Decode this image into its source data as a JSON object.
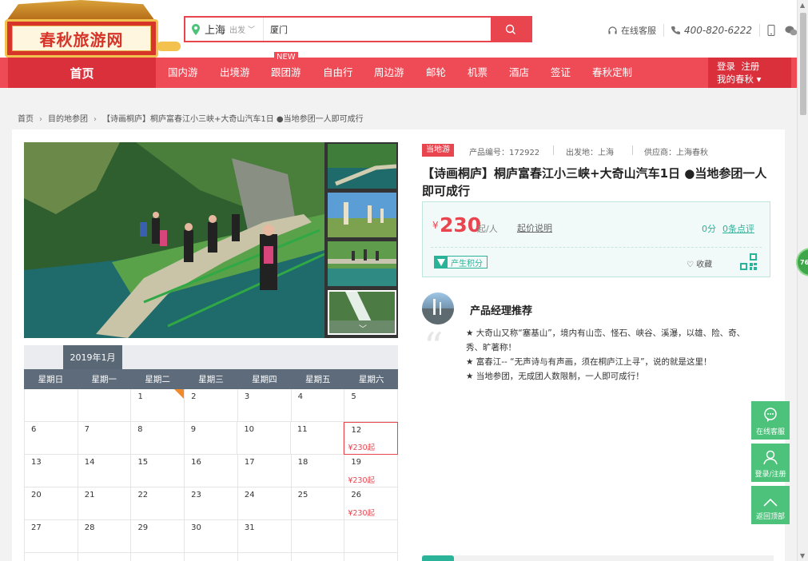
{
  "logo": {
    "text": "春秋旅游网"
  },
  "search": {
    "city": "上海",
    "from_label": "出发",
    "caret": "﹀",
    "value": "厦门",
    "placeholder": ""
  },
  "header": {
    "service": "在线客服",
    "phone": "400-820-6222"
  },
  "nav": {
    "home": "首页",
    "items": [
      "国内游",
      "出境游",
      "跟团游",
      "自由行",
      "周边游",
      "邮轮",
      "机票",
      "酒店",
      "签证",
      "春秋定制"
    ],
    "new_badge": "NEW",
    "login": "登录",
    "register": "注册",
    "mine": "我的春秋 ▾"
  },
  "breadcrumb": {
    "items": [
      "首页",
      "目的地参团",
      "【诗画桐庐】桐庐富春江小三峡+大奇山汽车1日 ●当地参团一人即可成行"
    ],
    "arrow": "›"
  },
  "product": {
    "badge": "当地游",
    "code_label": "产品编号：172922",
    "departure_label": "出发地：上海",
    "supplier_label": "供应商：上海春秋",
    "title": "【诗画桐庐】桐庐富春江小三峡+大奇山汽车1日 ●当地参团一人即可成行",
    "price_symbol": "¥",
    "price": "230",
    "price_unit": "起/人",
    "price_explain": "起价说明",
    "score": "0分",
    "reviews": "0条点评",
    "points": "产生积分",
    "favorite": "♡ 收藏"
  },
  "manager": {
    "title": "产品经理推荐",
    "quote_mark": "“",
    "lines": [
      "★ 大奇山又称“塞基山”，境内有山峦、怪石、峡谷、溪瀑，以雄、险、奇、秀、旷著称！",
      "★ 富春江-- “无声诗与有声画，须在桐庐江上寻”，说的就是这里！",
      "★ 当地参团，无成团人数限制，一人即可成行！"
    ]
  },
  "calendar": {
    "month": "2019年1月",
    "weekdays": [
      "星期日",
      "星期一",
      "星期二",
      "星期三",
      "星期四",
      "星期五",
      "星期六"
    ],
    "rows": [
      [
        {
          "d": ""
        },
        {
          "d": ""
        },
        {
          "d": "1",
          "corner": true
        },
        {
          "d": "2"
        },
        {
          "d": "3"
        },
        {
          "d": "4"
        },
        {
          "d": "5"
        }
      ],
      [
        {
          "d": "6"
        },
        {
          "d": "7"
        },
        {
          "d": "8"
        },
        {
          "d": "9"
        },
        {
          "d": "10"
        },
        {
          "d": "11"
        },
        {
          "d": "12",
          "price": "¥230起",
          "selected": true
        }
      ],
      [
        {
          "d": "13"
        },
        {
          "d": "14"
        },
        {
          "d": "15"
        },
        {
          "d": "16"
        },
        {
          "d": "17"
        },
        {
          "d": "18"
        },
        {
          "d": "19",
          "price": "¥230起"
        }
      ],
      [
        {
          "d": "20"
        },
        {
          "d": "21"
        },
        {
          "d": "22"
        },
        {
          "d": "23"
        },
        {
          "d": "24"
        },
        {
          "d": "25"
        },
        {
          "d": "26",
          "price": "¥230起"
        }
      ],
      [
        {
          "d": "27"
        },
        {
          "d": "28"
        },
        {
          "d": "29"
        },
        {
          "d": "30"
        },
        {
          "d": "31"
        },
        {
          "d": ""
        },
        {
          "d": ""
        }
      ],
      [
        {
          "d": ""
        },
        {
          "d": ""
        },
        {
          "d": ""
        },
        {
          "d": ""
        },
        {
          "d": ""
        },
        {
          "d": ""
        },
        {
          "d": ""
        }
      ]
    ]
  },
  "float": {
    "service": "在线客服",
    "login": "登录/注册",
    "top": "返回顶部",
    "side_tab": "76"
  },
  "colors": {
    "brand_red": "#e8454f",
    "nav_red": "#ee4b56",
    "teal": "#2bb39a",
    "float_green": "#4cc27b"
  }
}
